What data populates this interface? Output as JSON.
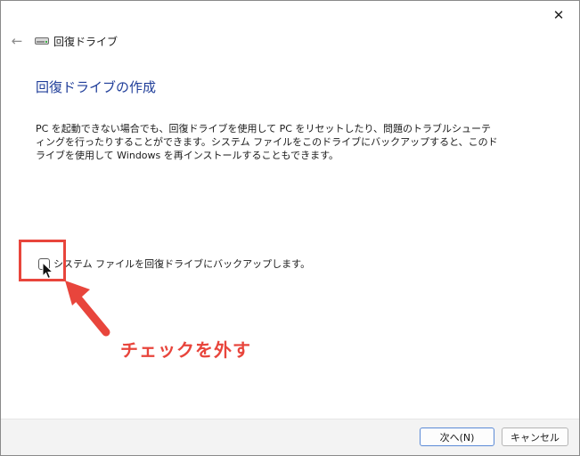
{
  "window": {
    "close_glyph": "✕"
  },
  "header": {
    "back_glyph": "←",
    "title": "回復ドライブ"
  },
  "main": {
    "heading": "回復ドライブの作成",
    "description": "PC を起動できない場合でも、回復ドライブを使用して PC をリセットしたり、問題のトラブルシューティングを行ったりすることができます。システム ファイルをこのドライブにバックアップすると、このドライブを使用して Windows を再インストールすることもできます。",
    "backup_checkbox": {
      "label": "システム ファイルを回復ドライブにバックアップします。",
      "checked": false
    }
  },
  "annotation": {
    "text": "チェックを外す",
    "color": "#e8453c"
  },
  "footer": {
    "next_label": "次へ(N)",
    "cancel_label": "キャンセル"
  },
  "colors": {
    "heading": "#1f3d99",
    "accent_border": "#5b8ad6"
  }
}
